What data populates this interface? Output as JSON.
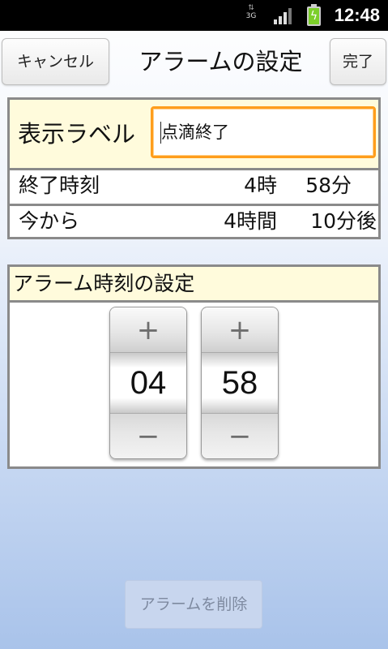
{
  "status_bar": {
    "network": "3G",
    "time": "12:48",
    "icons": [
      "network-3g-icon",
      "signal-icon",
      "battery-charging-icon"
    ]
  },
  "header": {
    "cancel_label": "キャンセル",
    "title": "アラームの設定",
    "done_label": "完了"
  },
  "display_label": {
    "label": "表示ラベル",
    "value": "点滴終了"
  },
  "end_time": {
    "label": "終了時刻",
    "hour": "4時",
    "minute": "58分"
  },
  "from_now": {
    "label": "今から",
    "hours": "4時間",
    "minutes": "10分後"
  },
  "alarm_time": {
    "header": "アラーム時刻の設定",
    "hour_value": "04",
    "minute_value": "58",
    "plus_symbol": "+",
    "minus_symbol": "−"
  },
  "delete_label": "アラームを削除",
  "colors": {
    "input_focus": "#ff9d1c",
    "row_highlight": "#fffbdc",
    "border": "#8a8a8a"
  }
}
